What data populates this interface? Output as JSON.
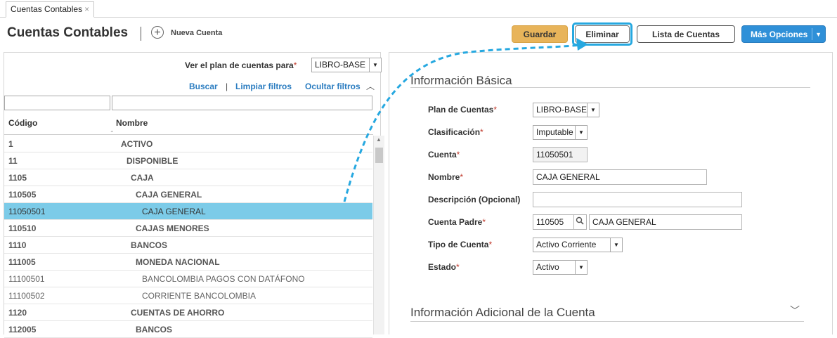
{
  "tab": {
    "label": "Cuentas Contables",
    "close": "×"
  },
  "header": {
    "title": "Cuentas Contables",
    "new_label": "Nueva Cuenta",
    "plus": "+"
  },
  "toolbar": {
    "guardar": "Guardar",
    "eliminar": "Eliminar",
    "lista": "Lista de Cuentas",
    "mas": "Más Opciones",
    "caret": "▼"
  },
  "left": {
    "ver_label": "Ver el plan de cuentas para",
    "required_mark": "*",
    "ver_value": "LIBRO-BASE",
    "buscar": "Buscar",
    "pipe": "|",
    "limpiar": "Limpiar filtros",
    "ocultar": "Ocultar filtros",
    "chev_up": "︿",
    "col_codigo": "Código",
    "col_nombre": "Nombre",
    "rows": [
      {
        "code": "1",
        "name": "ACTIVO",
        "style": "bold",
        "indent": 1
      },
      {
        "code": "11",
        "name": "DISPONIBLE",
        "style": "bold",
        "indent": 2
      },
      {
        "code": "1105",
        "name": "CAJA",
        "style": "bold",
        "indent": 3
      },
      {
        "code": "110505",
        "name": "CAJA GENERAL",
        "style": "bold",
        "indent": 4
      },
      {
        "code": "11050501",
        "name": "CAJA GENERAL",
        "style": "sel",
        "indent": 5
      },
      {
        "code": "110510",
        "name": "CAJAS MENORES",
        "style": "bold",
        "indent": 4
      },
      {
        "code": "1110",
        "name": "BANCOS",
        "style": "bold",
        "indent": 3
      },
      {
        "code": "111005",
        "name": "MONEDA NACIONAL",
        "style": "bold",
        "indent": 4
      },
      {
        "code": "11100501",
        "name": "BANCOLOMBIA PAGOS CON DATÁFONO",
        "style": "light",
        "indent": 5
      },
      {
        "code": "11100502",
        "name": "CORRIENTE BANCOLOMBIA",
        "style": "light",
        "indent": 5
      },
      {
        "code": "1120",
        "name": "CUENTAS DE AHORRO",
        "style": "bold",
        "indent": 3
      },
      {
        "code": "112005",
        "name": "BANCOS",
        "style": "bold",
        "indent": 4
      }
    ]
  },
  "right": {
    "basic_title": "Información Básica",
    "fields": {
      "plan_label": "Plan de Cuentas",
      "plan_value": "LIBRO-BASE",
      "clasif_label": "Clasificación",
      "clasif_value": "Imputable",
      "cuenta_label": "Cuenta",
      "cuenta_value": "11050501",
      "nombre_label": "Nombre",
      "nombre_value": "CAJA GENERAL",
      "desc_label": "Descripción (Opcional)",
      "desc_value": "",
      "padre_label": "Cuenta Padre",
      "padre_code": "110505",
      "padre_name": "CAJA GENERAL",
      "tipo_label": "Tipo de Cuenta",
      "tipo_value": "Activo Corriente",
      "estado_label": "Estado",
      "estado_value": "Activo"
    },
    "additional_title": "Información Adicional de la Cuenta",
    "chev_down": "﹀"
  },
  "icons": {
    "search": "search-icon",
    "dropdown": "dropdown-arrow-icon"
  },
  "colors": {
    "primary": "#2f90d8",
    "save": "#e8b45a",
    "selected_row": "#7ccbe8",
    "link": "#2a7cc0",
    "highlight": "#26a8e0"
  }
}
